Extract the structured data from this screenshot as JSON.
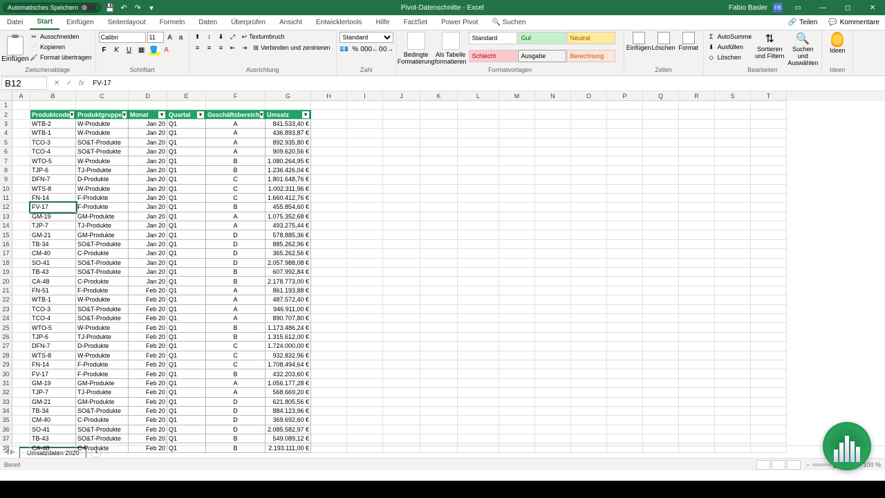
{
  "title": {
    "autosave": "Automatisches Speichern",
    "doc": "Pivot-Datenschnitte - Excel",
    "user": "Fabio Basler",
    "user_initials": "FB"
  },
  "tabs": {
    "datei": "Datei",
    "start": "Start",
    "einfuegen": "Einfügen",
    "seitenlayout": "Seitenlayout",
    "formeln": "Formeln",
    "daten": "Daten",
    "ueberpruefen": "Überprüfen",
    "ansicht": "Ansicht",
    "entwickler": "Entwicklertools",
    "hilfe": "Hilfe",
    "factset": "FactSet",
    "powerpivot": "Power Pivot",
    "suchen": "Suchen",
    "teilen": "Teilen",
    "kommentare": "Kommentare"
  },
  "ribbon": {
    "clipboard": {
      "einfuegen": "Einfügen",
      "ausschneiden": "Ausschneiden",
      "kopieren": "Kopieren",
      "format": "Format übertragen",
      "label": "Zwischenablage"
    },
    "font": {
      "name": "Calibri",
      "size": "11",
      "label": "Schriftart"
    },
    "align": {
      "textumbruch": "Textumbruch",
      "verbinden": "Verbinden und zentrieren",
      "label": "Ausrichtung"
    },
    "number": {
      "format": "Standard",
      "label": "Zahl"
    },
    "styles": {
      "bedingte": "Bedingte Formatierung",
      "tabelle": "Als Tabelle formatieren",
      "standard": "Standard",
      "gut": "Gut",
      "neutral": "Neutral",
      "schlecht": "Schlecht",
      "ausgabe": "Ausgabe",
      "berechnung": "Berechnung",
      "label": "Formatvorlagen"
    },
    "cells": {
      "einfuegen": "Einfügen",
      "loeschen": "Löschen",
      "format": "Format",
      "label": "Zellen"
    },
    "editing": {
      "autosumme": "AutoSumme",
      "ausfuellen": "Ausfüllen",
      "loeschen": "Löschen",
      "sortieren": "Sortieren und Filtern",
      "suchen": "Suchen und Auswählen",
      "label": "Bearbeiten"
    },
    "ideen": {
      "label": "Ideen"
    }
  },
  "namebox": "B12",
  "formula": "FV-17",
  "columns": [
    "A",
    "B",
    "C",
    "D",
    "E",
    "F",
    "G",
    "H",
    "I",
    "J",
    "K",
    "L",
    "M",
    "N",
    "O",
    "P",
    "Q",
    "R",
    "S",
    "T"
  ],
  "headers": {
    "code": "Produktcode",
    "gruppe": "Produktgruppe",
    "monat": "Monat",
    "quartal": "Quartal",
    "bereich": "Geschäftsbereich",
    "umsatz": "Umsatz"
  },
  "rows": [
    {
      "code": "WTB-2",
      "gruppe": "W-Produkte",
      "monat": "Jan 20",
      "quartal": "Q1",
      "bereich": "A",
      "umsatz": "841.533,40 €"
    },
    {
      "code": "WTB-1",
      "gruppe": "W-Produkte",
      "monat": "Jan 20",
      "quartal": "Q1",
      "bereich": "A",
      "umsatz": "436.893,87 €"
    },
    {
      "code": "TCO-3",
      "gruppe": "SO&T-Produkte",
      "monat": "Jan 20",
      "quartal": "Q1",
      "bereich": "A",
      "umsatz": "892.935,80 €"
    },
    {
      "code": "TCO-4",
      "gruppe": "SO&T-Produkte",
      "monat": "Jan 20",
      "quartal": "Q1",
      "bereich": "A",
      "umsatz": "909.620,56 €"
    },
    {
      "code": "WTO-5",
      "gruppe": "W-Produkte",
      "monat": "Jan 20",
      "quartal": "Q1",
      "bereich": "B",
      "umsatz": "1.080.264,95 €"
    },
    {
      "code": "TJP-6",
      "gruppe": "TJ-Produkte",
      "monat": "Jan 20",
      "quartal": "Q1",
      "bereich": "B",
      "umsatz": "1.236.426,04 €"
    },
    {
      "code": "DFN-7",
      "gruppe": "D-Produkte",
      "monat": "Jan 20",
      "quartal": "Q1",
      "bereich": "C",
      "umsatz": "1.801.648,76 €"
    },
    {
      "code": "WTS-8",
      "gruppe": "W-Produkte",
      "monat": "Jan 20",
      "quartal": "Q1",
      "bereich": "C",
      "umsatz": "1.002.311,96 €"
    },
    {
      "code": "FN-14",
      "gruppe": "F-Produkte",
      "monat": "Jan 20",
      "quartal": "Q1",
      "bereich": "C",
      "umsatz": "1.660.412,76 €"
    },
    {
      "code": "FV-17",
      "gruppe": "F-Produkte",
      "monat": "Jan 20",
      "quartal": "Q1",
      "bereich": "B",
      "umsatz": "455.854,60 €"
    },
    {
      "code": "GM-19",
      "gruppe": "GM-Produkte",
      "monat": "Jan 20",
      "quartal": "Q1",
      "bereich": "A",
      "umsatz": "1.075.352,68 €"
    },
    {
      "code": "TJP-7",
      "gruppe": "TJ-Produkte",
      "monat": "Jan 20",
      "quartal": "Q1",
      "bereich": "A",
      "umsatz": "493.275,44 €"
    },
    {
      "code": "GM-21",
      "gruppe": "GM-Produkte",
      "monat": "Jan 20",
      "quartal": "Q1",
      "bereich": "D",
      "umsatz": "578.885,36 €"
    },
    {
      "code": "TB-34",
      "gruppe": "SO&T-Produkte",
      "monat": "Jan 20",
      "quartal": "Q1",
      "bereich": "D",
      "umsatz": "885.262,96 €"
    },
    {
      "code": "CM-40",
      "gruppe": "C-Produkte",
      "monat": "Jan 20",
      "quartal": "Q1",
      "bereich": "D",
      "umsatz": "365.262,56 €"
    },
    {
      "code": "SO-41",
      "gruppe": "SO&T-Produkte",
      "monat": "Jan 20",
      "quartal": "Q1",
      "bereich": "D",
      "umsatz": "2.057.988,08 €"
    },
    {
      "code": "TB-43",
      "gruppe": "SO&T-Produkte",
      "monat": "Jan 20",
      "quartal": "Q1",
      "bereich": "B",
      "umsatz": "607.992,84 €"
    },
    {
      "code": "CA-48",
      "gruppe": "C-Produkte",
      "monat": "Jan 20",
      "quartal": "Q1",
      "bereich": "B",
      "umsatz": "2.178.773,00 €"
    },
    {
      "code": "FN-51",
      "gruppe": "F-Produkte",
      "monat": "Feb 20",
      "quartal": "Q1",
      "bereich": "A",
      "umsatz": "861.193,88 €"
    },
    {
      "code": "WTB-1",
      "gruppe": "W-Produkte",
      "monat": "Feb 20",
      "quartal": "Q1",
      "bereich": "A",
      "umsatz": "487.572,40 €"
    },
    {
      "code": "TCO-3",
      "gruppe": "SO&T-Produkte",
      "monat": "Feb 20",
      "quartal": "Q1",
      "bereich": "A",
      "umsatz": "946.911,00 €"
    },
    {
      "code": "TCO-4",
      "gruppe": "SO&T-Produkte",
      "monat": "Feb 20",
      "quartal": "Q1",
      "bereich": "A",
      "umsatz": "890.707,80 €"
    },
    {
      "code": "WTO-5",
      "gruppe": "W-Produkte",
      "monat": "Feb 20",
      "quartal": "Q1",
      "bereich": "B",
      "umsatz": "1.173.486,24 €"
    },
    {
      "code": "TJP-6",
      "gruppe": "TJ-Produkte",
      "monat": "Feb 20",
      "quartal": "Q1",
      "bereich": "B",
      "umsatz": "1.315.612,00 €"
    },
    {
      "code": "DFN-7",
      "gruppe": "D-Produkte",
      "monat": "Feb 20",
      "quartal": "Q1",
      "bereich": "C",
      "umsatz": "1.724.000,00 €"
    },
    {
      "code": "WTS-8",
      "gruppe": "W-Produkte",
      "monat": "Feb 20",
      "quartal": "Q1",
      "bereich": "C",
      "umsatz": "932.832,96 €"
    },
    {
      "code": "FN-14",
      "gruppe": "F-Produkte",
      "monat": "Feb 20",
      "quartal": "Q1",
      "bereich": "C",
      "umsatz": "1.708.494,64 €"
    },
    {
      "code": "FV-17",
      "gruppe": "F-Produkte",
      "monat": "Feb 20",
      "quartal": "Q1",
      "bereich": "B",
      "umsatz": "432.203,60 €"
    },
    {
      "code": "GM-19",
      "gruppe": "GM-Produkte",
      "monat": "Feb 20",
      "quartal": "Q1",
      "bereich": "A",
      "umsatz": "1.056.177,28 €"
    },
    {
      "code": "TJP-7",
      "gruppe": "TJ-Produkte",
      "monat": "Feb 20",
      "quartal": "Q1",
      "bereich": "A",
      "umsatz": "568.669,20 €"
    },
    {
      "code": "GM-21",
      "gruppe": "GM-Produkte",
      "monat": "Feb 20",
      "quartal": "Q1",
      "bereich": "D",
      "umsatz": "621.805,56 €"
    },
    {
      "code": "TB-34",
      "gruppe": "SO&T-Produkte",
      "monat": "Feb 20",
      "quartal": "Q1",
      "bereich": "D",
      "umsatz": "884.123,96 €"
    },
    {
      "code": "CM-40",
      "gruppe": "C-Produkte",
      "monat": "Feb 20",
      "quartal": "Q1",
      "bereich": "D",
      "umsatz": "369.692,60 €"
    },
    {
      "code": "SO-41",
      "gruppe": "SO&T-Produkte",
      "monat": "Feb 20",
      "quartal": "Q1",
      "bereich": "D",
      "umsatz": "2.085.582,97 €"
    },
    {
      "code": "TB-43",
      "gruppe": "SO&T-Produkte",
      "monat": "Feb 20",
      "quartal": "Q1",
      "bereich": "B",
      "umsatz": "549.089,12 €"
    },
    {
      "code": "CA-48",
      "gruppe": "C-Produkte",
      "monat": "Feb 20",
      "quartal": "Q1",
      "bereich": "B",
      "umsatz": "2.193.111,00 €"
    }
  ],
  "sheet": "Umsatzdaten 2020",
  "status": "Bereit",
  "zoom": "100 %"
}
